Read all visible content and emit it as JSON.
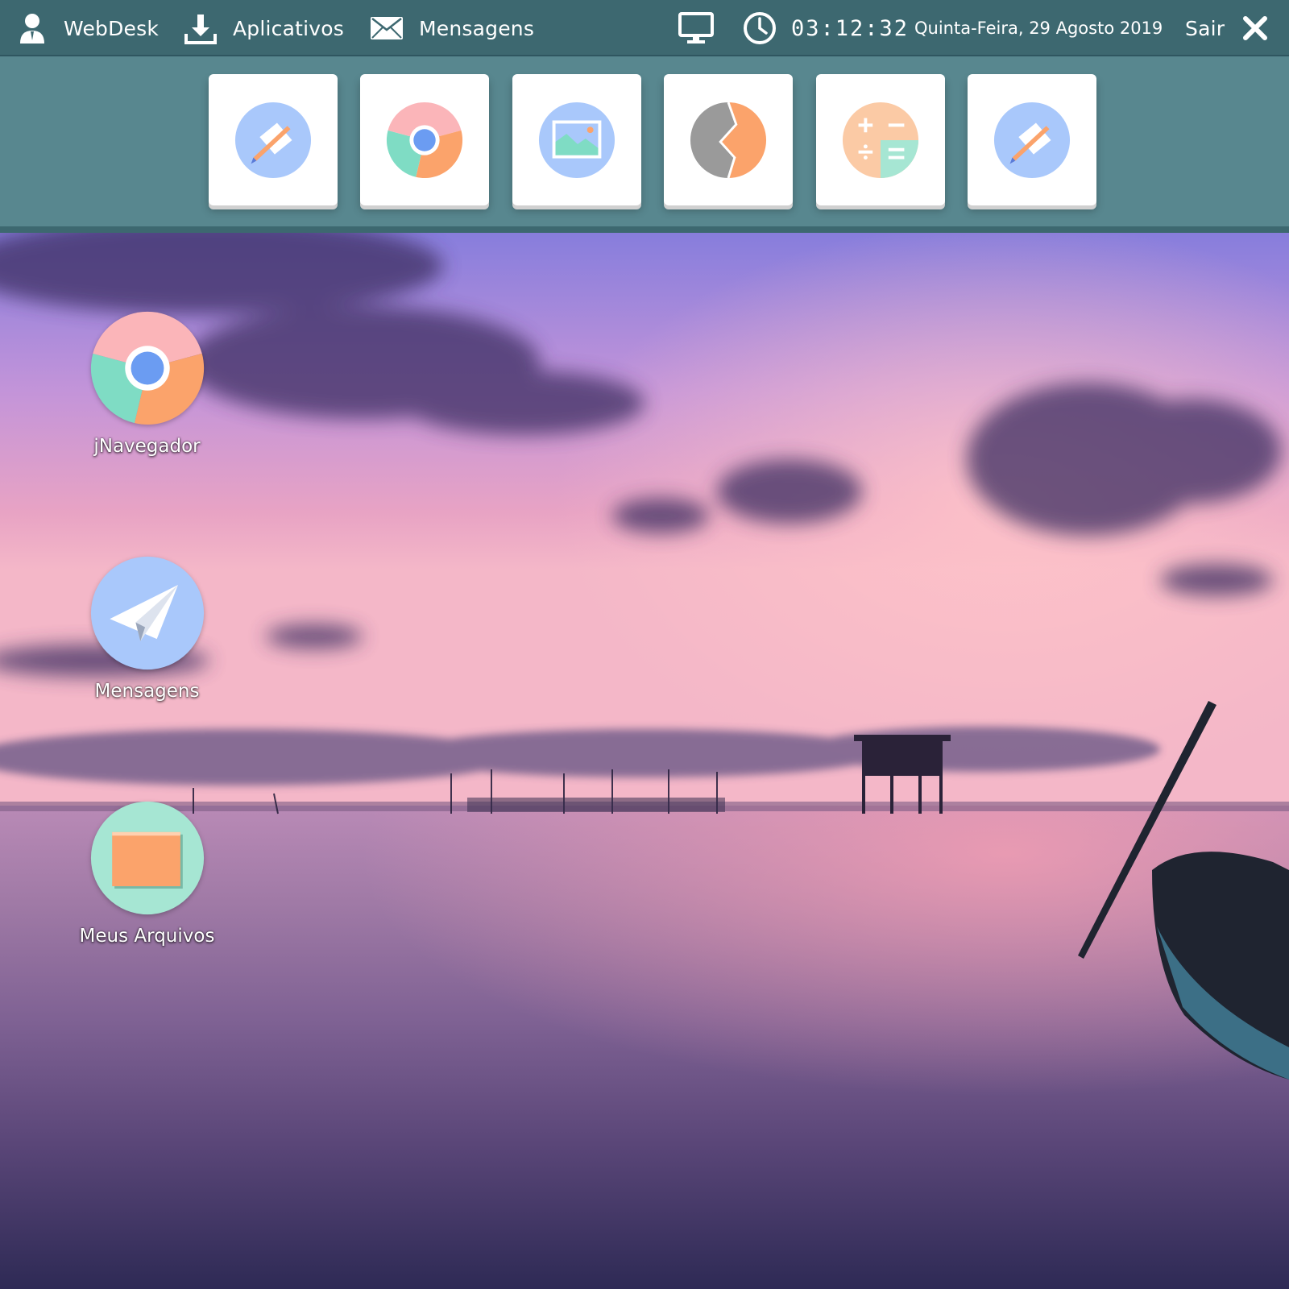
{
  "colors": {
    "topbar": "#3d6870",
    "launcher": "#58878f",
    "tile": "#ffffff",
    "accent_blue": "#a9c8fb",
    "accent_orange": "#fba36b",
    "accent_green": "#7fdcc4",
    "accent_pink": "#fbb5b9"
  },
  "topbar": {
    "user": {
      "label": "WebDesk",
      "icon": "user-icon"
    },
    "apps": {
      "label": "Aplicativos",
      "icon": "download-icon"
    },
    "messages": {
      "label": "Mensagens",
      "icon": "envelope-icon"
    },
    "desktop_icon": "monitor-icon",
    "clock_icon": "clock-icon",
    "time": "03:12:32",
    "date": "Quinta-Feira, 29 Agosto 2019",
    "logout": {
      "label": "Sair",
      "icon": "close-icon"
    }
  },
  "launcher": {
    "tiles": [
      {
        "icon": "text-editor-icon"
      },
      {
        "icon": "browser-icon"
      },
      {
        "icon": "image-viewer-icon"
      },
      {
        "icon": "clock-app-icon"
      },
      {
        "icon": "calculator-icon"
      },
      {
        "icon": "text-editor-icon"
      }
    ]
  },
  "desktop": {
    "icons": [
      {
        "label": "jNavegador",
        "icon": "browser-icon"
      },
      {
        "label": "Mensagens",
        "icon": "paper-plane-icon"
      },
      {
        "label": "Meus Arquivos",
        "icon": "folder-icon"
      }
    ]
  }
}
